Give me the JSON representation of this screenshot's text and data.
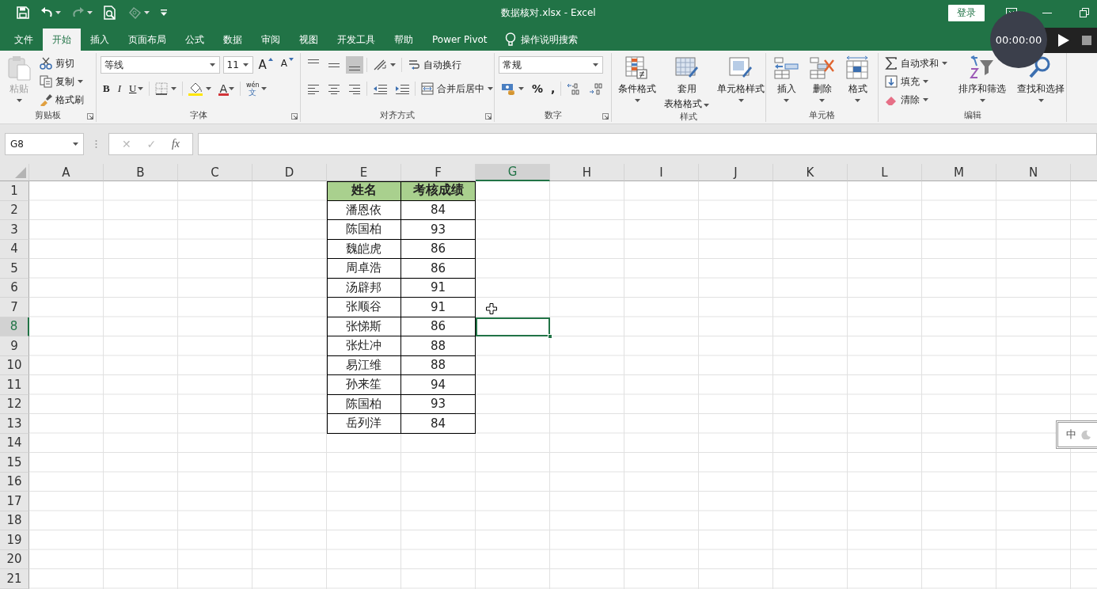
{
  "title_bar": {
    "title": "数据核对.xlsx  -  Excel",
    "login": "登录"
  },
  "menu_tabs": [
    {
      "label": "文件",
      "selected": false
    },
    {
      "label": "开始",
      "selected": true
    },
    {
      "label": "插入",
      "selected": false
    },
    {
      "label": "页面布局",
      "selected": false
    },
    {
      "label": "公式",
      "selected": false
    },
    {
      "label": "数据",
      "selected": false
    },
    {
      "label": "审阅",
      "selected": false
    },
    {
      "label": "视图",
      "selected": false
    },
    {
      "label": "开发工具",
      "selected": false
    },
    {
      "label": "帮助",
      "selected": false
    },
    {
      "label": "Power Pivot",
      "selected": false
    }
  ],
  "tell_me": {
    "label": "操作说明搜索"
  },
  "recorder": {
    "time": "00:00:00"
  },
  "ribbon": {
    "clipboard": {
      "label": "剪贴板",
      "paste": {
        "label": "粘贴",
        "disabled": true
      },
      "commands": [
        "剪切",
        "复制",
        "格式刷"
      ]
    },
    "font": {
      "label": "字体",
      "font_name": "等线",
      "font_size": "11",
      "grow": "A",
      "shrink": "A",
      "styles": [
        "B",
        "I",
        "U"
      ],
      "font_color": "A",
      "phonetic": [
        "wén",
        "文"
      ]
    },
    "alignment": {
      "label": "对齐方式",
      "vertical_align": [
        {
          "selected": false
        },
        {
          "selected": false
        },
        {
          "selected": true
        }
      ],
      "wrap": "自动换行",
      "merge": "合并后居中"
    },
    "number": {
      "label": "数字",
      "format": "常规",
      "percent": "%",
      "comma": ","
    },
    "styles": {
      "label": "样式",
      "buttons": [
        {
          "lines": [
            "条件格式"
          ]
        },
        {
          "lines": [
            "套用",
            "表格格式"
          ]
        },
        {
          "lines": [
            "单元格样式"
          ]
        }
      ]
    },
    "cells": {
      "label": "单元格",
      "buttons": [
        {
          "lines": [
            "插入"
          ]
        },
        {
          "lines": [
            "删除"
          ]
        },
        {
          "lines": [
            "格式"
          ]
        }
      ]
    },
    "editing": {
      "label": "编辑",
      "commands": [
        "自动求和",
        "填充",
        "清除"
      ],
      "buttons": [
        {
          "lines": [
            "排序和筛选"
          ]
        },
        {
          "lines": [
            "查找和选择"
          ]
        }
      ]
    }
  },
  "formula_bar": {
    "name_box": "G8",
    "cancel": "✕",
    "enter": "✓",
    "function": "fx"
  },
  "sheet": {
    "columns": [
      {
        "label": "A",
        "selected": false
      },
      {
        "label": "B",
        "selected": false
      },
      {
        "label": "C",
        "selected": false
      },
      {
        "label": "D",
        "selected": false
      },
      {
        "label": "E",
        "selected": false
      },
      {
        "label": "F",
        "selected": false
      },
      {
        "label": "G",
        "selected": true
      },
      {
        "label": "H",
        "selected": false
      },
      {
        "label": "I",
        "selected": false
      },
      {
        "label": "J",
        "selected": false
      },
      {
        "label": "K",
        "selected": false
      },
      {
        "label": "L",
        "selected": false
      },
      {
        "label": "M",
        "selected": false
      },
      {
        "label": "N",
        "selected": false
      }
    ],
    "rows": [
      {
        "label": "1",
        "selected": false,
        "kind": "header",
        "values": [
          "姓名",
          "考核成绩"
        ]
      },
      {
        "label": "2",
        "selected": false,
        "kind": "data",
        "values": [
          "潘恩依",
          "84"
        ]
      },
      {
        "label": "3",
        "selected": false,
        "kind": "data",
        "values": [
          "陈国柏",
          "93"
        ]
      },
      {
        "label": "4",
        "selected": false,
        "kind": "data",
        "values": [
          "魏皑虎",
          "86"
        ]
      },
      {
        "label": "5",
        "selected": false,
        "kind": "data",
        "values": [
          "周卓浩",
          "86"
        ]
      },
      {
        "label": "6",
        "selected": false,
        "kind": "data",
        "values": [
          "汤辟邦",
          "91"
        ]
      },
      {
        "label": "7",
        "selected": false,
        "kind": "data",
        "values": [
          "张顺谷",
          "91"
        ]
      },
      {
        "label": "8",
        "selected": true,
        "kind": "data",
        "values": [
          "张悌斯",
          "86"
        ]
      },
      {
        "label": "9",
        "selected": false,
        "kind": "data",
        "values": [
          "张灶冲",
          "88"
        ]
      },
      {
        "label": "10",
        "selected": false,
        "kind": "data",
        "values": [
          "易江维",
          "88"
        ]
      },
      {
        "label": "11",
        "selected": false,
        "kind": "data",
        "values": [
          "孙来笙",
          "94"
        ]
      },
      {
        "label": "12",
        "selected": false,
        "kind": "data",
        "values": [
          "陈国柏",
          "93"
        ]
      },
      {
        "label": "13",
        "selected": false,
        "kind": "data",
        "values": [
          "岳列洋",
          "84"
        ]
      },
      {
        "label": "14",
        "selected": false
      },
      {
        "label": "15",
        "selected": false
      },
      {
        "label": "16",
        "selected": false
      },
      {
        "label": "17",
        "selected": false
      },
      {
        "label": "18",
        "selected": false
      },
      {
        "label": "19",
        "selected": false
      },
      {
        "label": "20",
        "selected": false
      },
      {
        "label": "21",
        "selected": false
      }
    ]
  },
  "ime": {
    "mode": "中"
  }
}
